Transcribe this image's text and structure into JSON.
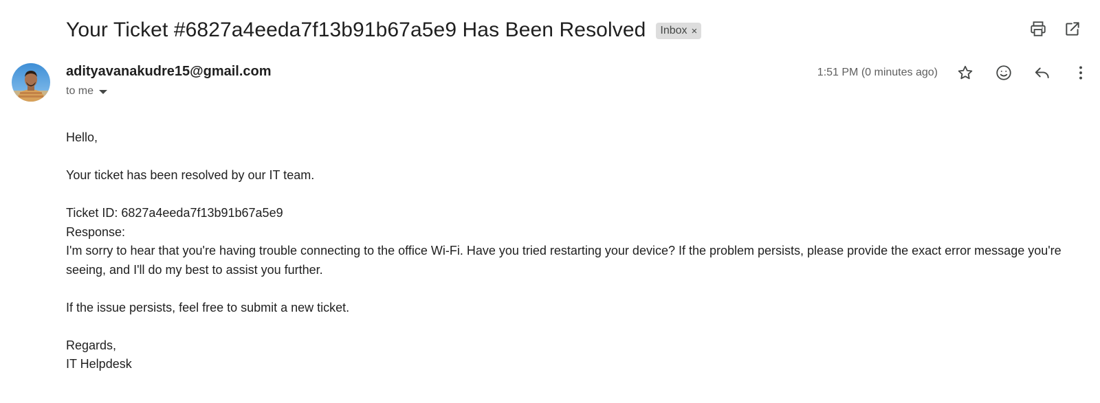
{
  "email": {
    "subject": "Your Ticket #6827a4eeda7f13b91b67a5e9 Has Been Resolved",
    "label": "Inbox",
    "label_remove": "×",
    "sender": "adityavanakudre15@gmail.com",
    "recipient": "to me",
    "timestamp": "1:51 PM (0 minutes ago)"
  },
  "body": {
    "greeting": "Hello,",
    "line_resolved": "Your ticket has been resolved by our IT team.",
    "ticket_id": "Ticket ID: 6827a4eeda7f13b91b67a5e9",
    "response_label": "Response:",
    "response_text": "I'm sorry to hear that you're having trouble connecting to the office Wi-Fi. Have you tried restarting your device? If the problem persists, please provide the exact error message you're seeing, and I'll do my best to assist you further.",
    "followup": "If the issue persists, feel free to submit a new ticket.",
    "closing": "Regards,",
    "signature": "IT Helpdesk"
  },
  "icons": {
    "print": "print-icon",
    "open_new_window": "open-in-new-icon",
    "star": "star-icon",
    "emoji": "emoji-icon",
    "reply": "reply-icon",
    "more": "more-vert-icon"
  },
  "colors": {
    "text_primary": "#1f1f1f",
    "text_secondary": "#5e5e5e",
    "chip_bg": "#dddddd",
    "icon": "#444746"
  }
}
